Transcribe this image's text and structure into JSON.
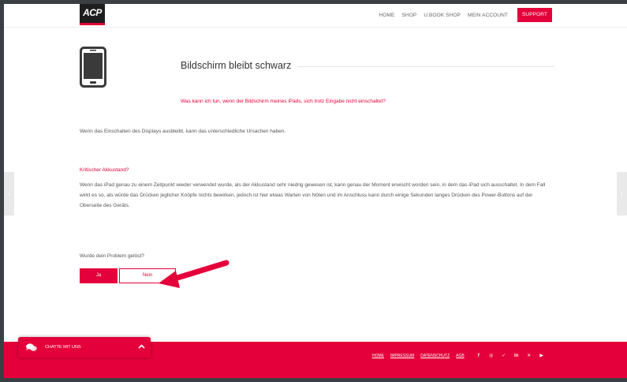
{
  "header": {
    "logo_text": "ACP",
    "nav": [
      "HOME",
      "SHOP",
      "U.BOOK SHOP",
      "MEIN ACCOUNT"
    ],
    "support_label": "SUPPORT"
  },
  "main": {
    "title": "Bildschirm bleibt schwarz",
    "subtitle": "Was kann ich tun, wenn der Bildschirm meines iPads, sich trotz Eingabe nicht einschaltet?",
    "intro": "Wenn das Einschalten des Displays ausbleibt, kann das unterschiedliche Ursachen haben.",
    "section_heading": "Kritischer Akkustand?",
    "section_text": "Wenn das iPad genau zu einem Zeitpunkt wieder verwendet wurde, als der Akkustand sehr niedrig gewesen ist, kann genau der Moment erwischt worden sein, in dem das iPad sich ausschaltet. In dem Fall wirkt es so, als würde das Drücken jeglicher Knöpfe nichts bewirken, jedoch ist hier etwas Warten von Nöten und im Anschluss kann durch einige Sekunden langes Drücken des Power-Buttons auf der Oberseite des Geräts.",
    "question": "Wurde dein Problem gelöst?",
    "yes_label": "Ja",
    "no_label": "Nein"
  },
  "side": {
    "left_arrow": "‹",
    "right_arrow": "›"
  },
  "footer": {
    "links": [
      "HOME",
      "IMPRESSUM",
      "DATENSCHUTZ",
      "AGB"
    ],
    "social": [
      {
        "icon": "facebook-icon",
        "glyph": "f"
      },
      {
        "icon": "instagram-icon",
        "glyph": "◎"
      },
      {
        "icon": "twitter-icon",
        "glyph": "✓"
      },
      {
        "icon": "linkedin-icon",
        "glyph": "in"
      },
      {
        "icon": "xing-icon",
        "glyph": "✕"
      },
      {
        "icon": "youtube-icon",
        "glyph": "▶"
      }
    ]
  },
  "chat": {
    "label": "CHATTE MIT UNS"
  },
  "colors": {
    "accent": "#e4003a",
    "dark": "#1e1e1e"
  }
}
